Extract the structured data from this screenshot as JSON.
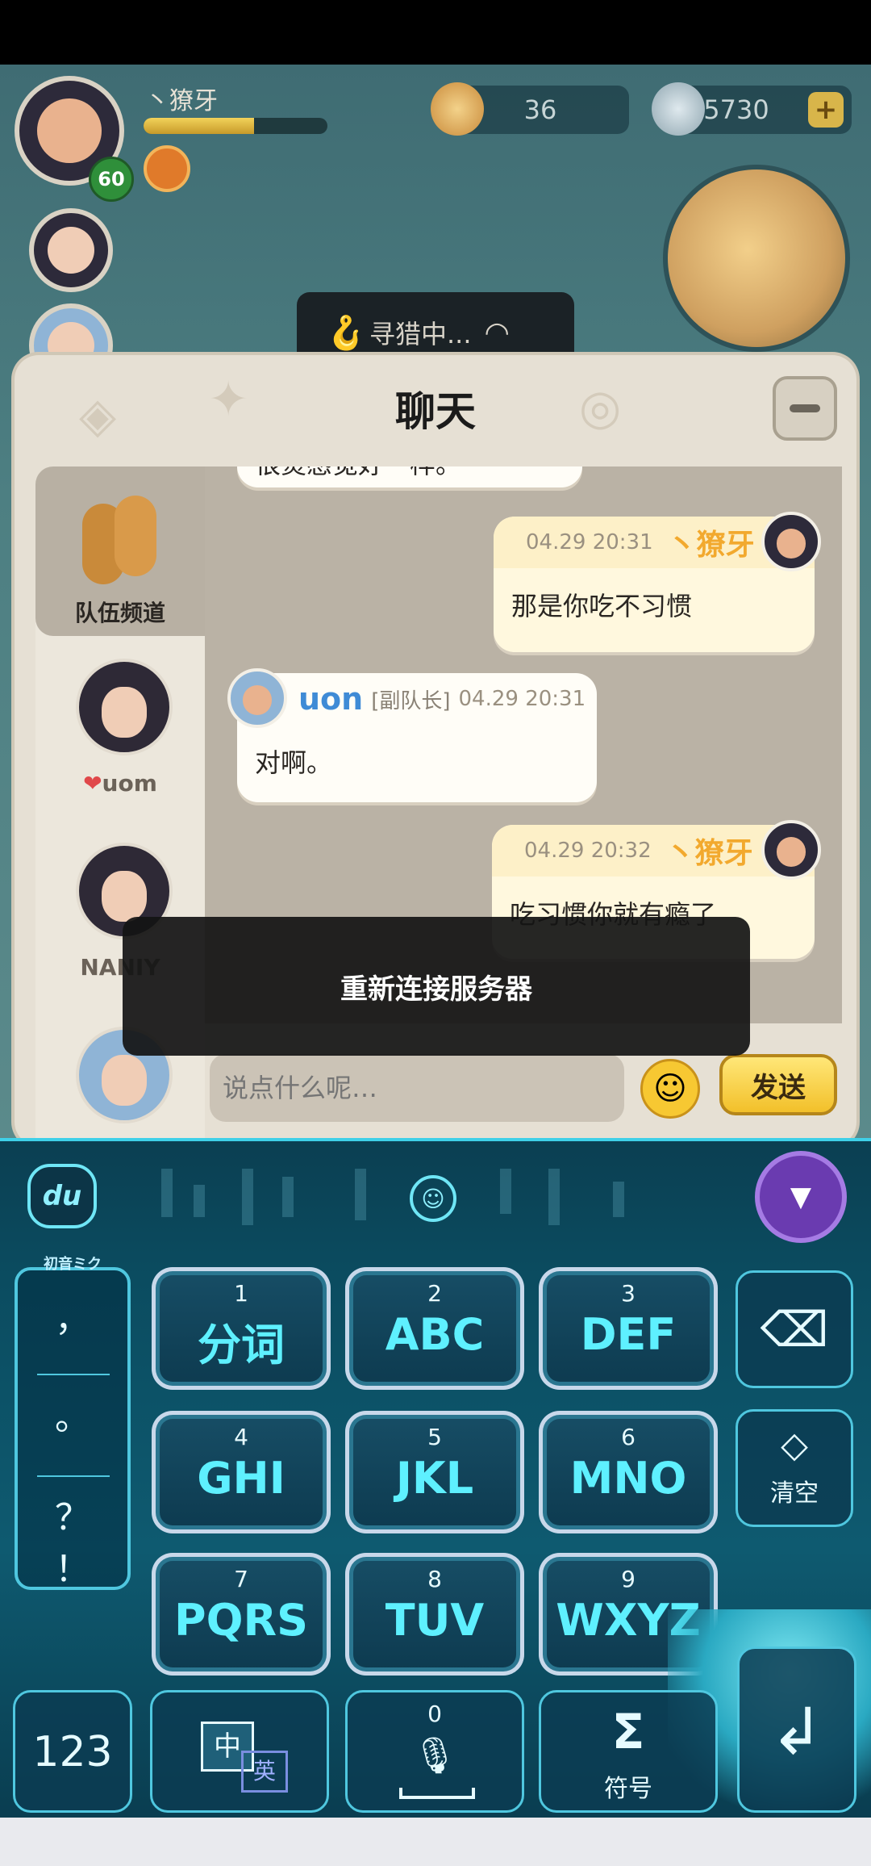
{
  "hud": {
    "player_name": "丶獠牙",
    "level": "60",
    "exp_fraction": 0.6,
    "currency1": "36",
    "currency2": "5730",
    "plus": "+",
    "hunting_status": "寻猎中..."
  },
  "chat": {
    "title": "聊天",
    "channel_tab_label": "队伍频道",
    "members": [
      {
        "name": "uom"
      },
      {
        "name": "NANIY"
      }
    ],
    "truncated_top_text": "很烫感觉好一样。",
    "messages": [
      {
        "time": "04.29 20:31",
        "sender": "丶獠牙",
        "text": "那是你吃不习惯",
        "mine": true
      },
      {
        "time": "04.29 20:31",
        "sender": "uon",
        "role": "[副队长]",
        "text": "对啊。",
        "mine": false
      },
      {
        "time": "04.29 20:32",
        "sender": "丶獠牙",
        "text": "吃习惯你就有瘾了",
        "mine": true
      }
    ],
    "input_placeholder": "说点什么呢…",
    "send_label": "发送",
    "toast": "重新连接服务器"
  },
  "keyboard": {
    "logo": "du",
    "skin_caption": "初音ミク",
    "punctuation": [
      "，",
      "。",
      "？",
      "！"
    ],
    "keys": [
      {
        "num": "1",
        "label": "分词"
      },
      {
        "num": "2",
        "label": "ABC"
      },
      {
        "num": "3",
        "label": "DEF"
      },
      {
        "num": "4",
        "label": "GHI"
      },
      {
        "num": "5",
        "label": "JKL"
      },
      {
        "num": "6",
        "label": "MNO"
      },
      {
        "num": "7",
        "label": "PQRS"
      },
      {
        "num": "8",
        "label": "TUV"
      },
      {
        "num": "9",
        "label": "WXYZ"
      }
    ],
    "clear_label": "清空",
    "numeric_label": "123",
    "lang_cn": "中",
    "lang_en": "英",
    "zero_label": "0",
    "symbol_label": "符号",
    "symbol_glyph": "Σ"
  },
  "colors": {
    "accent_orange": "#f2a92e",
    "accent_blue": "#3f8bd6",
    "keyboard_cyan": "#5ef0ff"
  }
}
